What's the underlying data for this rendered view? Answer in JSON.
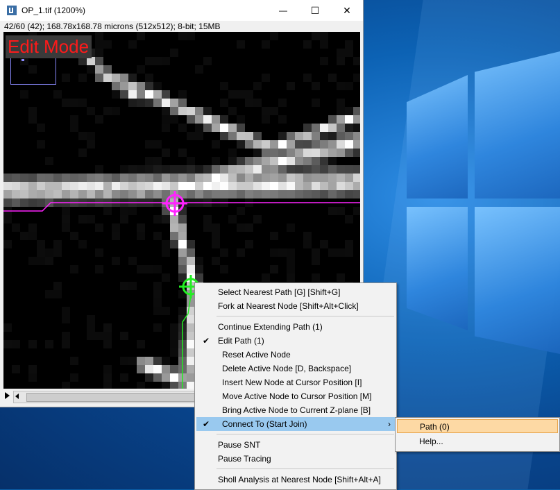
{
  "window": {
    "title": "OP_1.tif (1200%)",
    "subtitle": "42/60 (42); 168.78x168.78 microns (512x512); 8-bit; 15MB",
    "minimize_glyph": "—",
    "maximize_glyph": "☐",
    "close_glyph": "✕"
  },
  "canvas": {
    "mode_label": "Edit Mode"
  },
  "menu": {
    "items": [
      {
        "label": "Select Nearest Path  [G] [Shift+G]"
      },
      {
        "label": "Fork at Nearest Node  [Shift+Alt+Click]"
      },
      {
        "label": "Continue Extending Path (1)"
      },
      {
        "label": "Edit Path (1)",
        "check": "✔"
      },
      {
        "label": "Reset Active Node"
      },
      {
        "label": "Delete Active Node  [D, Backspace]"
      },
      {
        "label": "Insert New Node at Cursor Position  [I]"
      },
      {
        "label": "Move Active Node to Cursor Position  [M]"
      },
      {
        "label": "Bring Active Node to Current Z-plane  [B]"
      },
      {
        "label": "Connect To (Start Join)",
        "check": "✔",
        "arrow": "›"
      },
      {
        "label": "Pause SNT"
      },
      {
        "label": "Pause Tracing"
      },
      {
        "label": "Sholl Analysis at Nearest Node  [Shift+Alt+A]"
      }
    ]
  },
  "submenu": {
    "items": [
      {
        "label": "Path (0)"
      },
      {
        "label": "Help..."
      }
    ]
  },
  "colors": {
    "edit_mode_text": "#ff1a1a",
    "path_magenta": "#ff22ff",
    "path_green": "#22ee22",
    "menu_highlight": "#99c9ef",
    "submenu_highlight": "#fdd9a4"
  }
}
